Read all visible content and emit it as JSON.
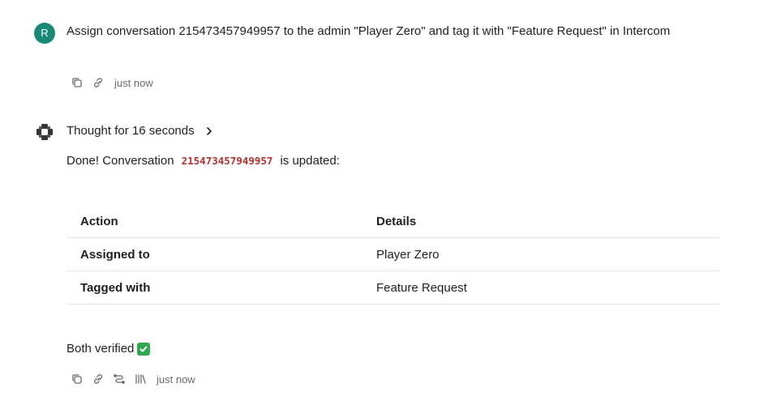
{
  "user_message": {
    "avatar_initial": "R",
    "avatar_color": "#1a8a78",
    "text": "Assign conversation 215473457949957 to the admin \"Player Zero\" and tag it with \"Feature Request\" in Intercom",
    "timestamp": "just now",
    "actions": [
      "copy-icon",
      "link-icon"
    ]
  },
  "assistant": {
    "thought_label": "Thought for 16 seconds",
    "intro_before": "Done! Conversation",
    "conversation_id": "215473457949957",
    "intro_after": "is updated:",
    "table": {
      "headers": [
        "Action",
        "Details"
      ],
      "rows": [
        [
          "Assigned to",
          "Player Zero"
        ],
        [
          "Tagged with",
          "Feature Request"
        ]
      ]
    },
    "verified_text": "Both verified",
    "verified_emoji": "check-mark-button-icon",
    "timestamp": "just now",
    "actions": [
      "copy-icon",
      "link-icon",
      "branch-icon",
      "library-icon"
    ]
  },
  "colors": {
    "code": "#b4322f",
    "muted": "#6b6b6b",
    "divider": "#e3e3e3"
  }
}
